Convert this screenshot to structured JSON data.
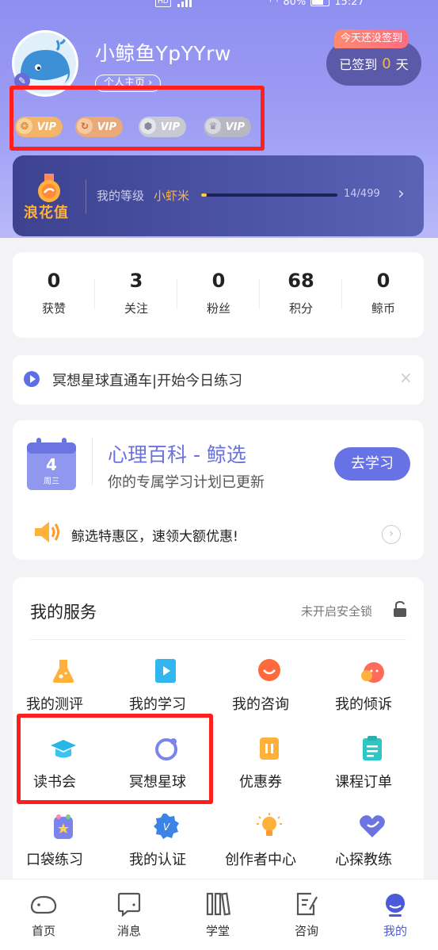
{
  "status_bar": {
    "hd": "HD",
    "battery": "80%",
    "time": "15:27"
  },
  "profile": {
    "username": "小鲸鱼YpYYrw",
    "home_link": "个人主页 ›",
    "checkin_tip": "今天还没签到",
    "checkin_prefix": "已签到",
    "checkin_days": "0",
    "checkin_suffix": "天"
  },
  "vip_badges": [
    {
      "label": "VIP",
      "icon": "vip-gold-icon",
      "color": "#f2b56a"
    },
    {
      "label": "VIP",
      "icon": "vip-orange-icon",
      "color": "#e9a979"
    },
    {
      "label": "VIP",
      "icon": "vip-silver-icon",
      "color": "#c9c9d4"
    },
    {
      "label": "VIP",
      "icon": "vip-crown-icon",
      "color": "#b8b8c4"
    }
  ],
  "level": {
    "title": "浪花值",
    "label": "我的等级",
    "name": "小虾米",
    "score": "14/499",
    "progress": 0.028
  },
  "stats": [
    {
      "value": "0",
      "label": "获赞"
    },
    {
      "value": "3",
      "label": "关注"
    },
    {
      "value": "0",
      "label": "粉丝"
    },
    {
      "value": "68",
      "label": "积分"
    },
    {
      "value": "0",
      "label": "鲸币"
    }
  ],
  "notice": {
    "text": "冥想星球直通车|开始今日练习",
    "close": "×"
  },
  "course": {
    "calendar_day": "4",
    "calendar_week": "周三",
    "title": "心理百科 - 鲸选",
    "subtitle": "你的专属学习计划已更新",
    "button": "去学习",
    "promo": "鲸选特惠区，速领大额优惠!",
    "promo_arrow": "›"
  },
  "services": {
    "title": "我的服务",
    "lock_text": "未开启安全锁",
    "items": [
      {
        "label": "我的测评",
        "icon": "flask-icon"
      },
      {
        "label": "我的学习",
        "icon": "video-play-icon"
      },
      {
        "label": "我的咨询",
        "icon": "chat-bubble-icon"
      },
      {
        "label": "我的倾诉",
        "icon": "tomato-face-icon"
      },
      {
        "label": "读书会",
        "icon": "graduation-cap-icon"
      },
      {
        "label": "冥想星球",
        "icon": "planet-ring-icon"
      },
      {
        "label": "优惠券",
        "icon": "coupon-icon"
      },
      {
        "label": "课程订单",
        "icon": "order-list-icon"
      },
      {
        "label": "口袋练习",
        "icon": "pocket-star-icon"
      },
      {
        "label": "我的认证",
        "icon": "verified-badge-icon"
      },
      {
        "label": "创作者中心",
        "icon": "lightbulb-icon"
      },
      {
        "label": "心探教练",
        "icon": "heart-coach-icon"
      }
    ]
  },
  "nav": [
    {
      "label": "首页",
      "icon": "whale-home-icon"
    },
    {
      "label": "消息",
      "icon": "message-icon"
    },
    {
      "label": "学堂",
      "icon": "books-icon"
    },
    {
      "label": "咨询",
      "icon": "consult-icon"
    },
    {
      "label": "我的",
      "icon": "profile-icon",
      "active": true
    }
  ]
}
